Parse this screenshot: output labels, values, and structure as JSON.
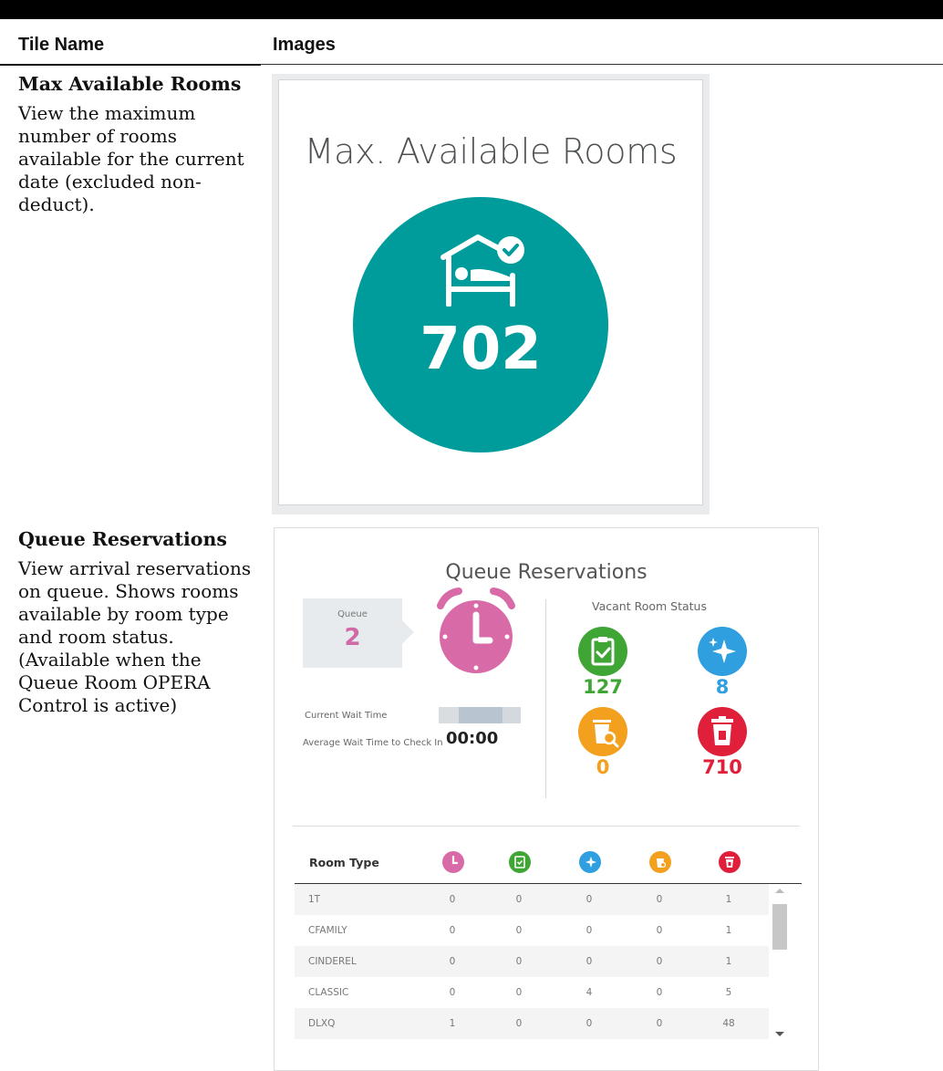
{
  "table": {
    "headers": {
      "tile_name": "Tile Name",
      "images": "Images"
    }
  },
  "rows": [
    {
      "name": "Max Available Rooms",
      "description": "View the maximum number of rooms available for the current date (excluded non-deduct).",
      "tile": {
        "title": "Max. Available Rooms",
        "icon": "bed-check-icon",
        "value": "702",
        "circle_color": "#009b9b"
      }
    },
    {
      "name": "Queue Reservations",
      "description": "View arrival reservations on queue. Shows rooms available by room type and room status. (Available when the Queue Room OPERA Control is active)",
      "tile": {
        "title": "Queue Reservations",
        "queue_label": "Queue",
        "queue_value": "2",
        "current_wait_label": "Current Wait Time",
        "average_wait_label": "Average Wait Time to Check In",
        "average_wait_value": "00:00",
        "vacant_label": "Vacant Room Status",
        "statuses": [
          {
            "icon": "clipboard-check-icon",
            "value": "127",
            "color": "#3fa535"
          },
          {
            "icon": "sparkle-icon",
            "value": "8",
            "color": "#2f9fe0"
          },
          {
            "icon": "trash-search-icon",
            "value": "0",
            "color": "#f2a01d"
          },
          {
            "icon": "trash-icon",
            "value": "710",
            "color": "#e0203a"
          }
        ],
        "queue_color": "#d96aa8",
        "table_header": "Room Type",
        "table_rows": [
          {
            "type": "1T",
            "values": [
              "0",
              "0",
              "0",
              "0",
              "1"
            ]
          },
          {
            "type": "CFAMILY",
            "values": [
              "0",
              "0",
              "0",
              "0",
              "1"
            ]
          },
          {
            "type": "CINDEREL",
            "values": [
              "0",
              "0",
              "0",
              "0",
              "1"
            ]
          },
          {
            "type": "CLASSIC",
            "values": [
              "0",
              "0",
              "4",
              "0",
              "5"
            ]
          },
          {
            "type": "DLXQ",
            "values": [
              "1",
              "0",
              "0",
              "0",
              "48"
            ]
          }
        ]
      }
    }
  ]
}
